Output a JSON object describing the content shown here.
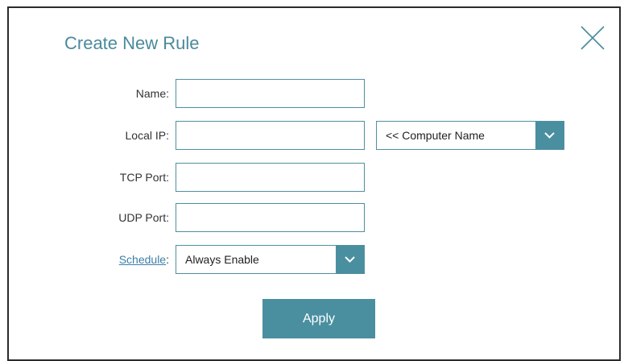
{
  "dialog": {
    "title": "Create New Rule",
    "close_icon": "close-x-icon"
  },
  "form": {
    "name_label": "Name:",
    "local_ip_label": "Local IP:",
    "tcp_port_label": "TCP Port:",
    "udp_port_label": "UDP Port:",
    "schedule_link": "Schedule",
    "schedule_colon": ":",
    "name_value": "",
    "local_ip_value": "",
    "tcp_port_value": "",
    "udp_port_value": "",
    "computer_name_select": "<< Computer Name",
    "schedule_select": "Always Enable",
    "chevron_icon": "chevron-down-icon"
  },
  "apply_label": "Apply",
  "colors": {
    "accent": "#4a8fa0",
    "title": "#4a8a9a",
    "link": "#3b7fa8"
  }
}
